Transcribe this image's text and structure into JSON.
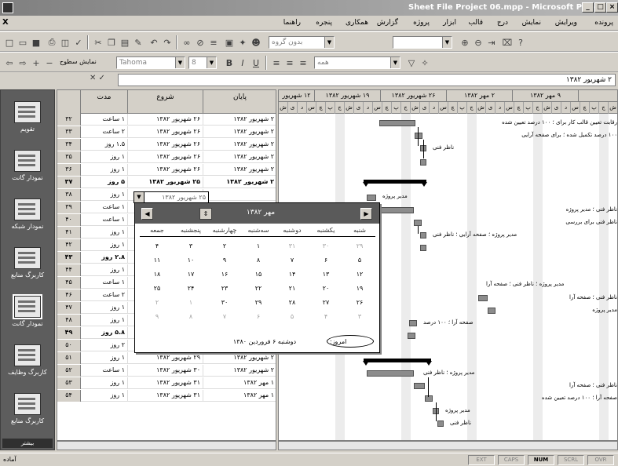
{
  "window": {
    "title": "Sheet File Project 06.mpp - Microsoft Project",
    "buttons": [
      "_",
      "□",
      "×"
    ]
  },
  "menubar": {
    "doc_icon": "X",
    "items": [
      "پرونده",
      "ویرایش",
      "نمایش",
      "درج",
      "قالب",
      "ابزار",
      "پروژه",
      "گزارش",
      "همکاری",
      "پنجره",
      "راهنما"
    ]
  },
  "toolbar1": {
    "icons": [
      "new-icon",
      "open-icon",
      "save-icon",
      "print-icon",
      "preview-icon",
      "spell-icon",
      "cut-icon",
      "copy-icon",
      "paste-icon",
      "format-painter-icon",
      "undo-icon",
      "redo-icon",
      "link-icon",
      "unlink-icon",
      "split-icon",
      "info-icon",
      "notes-icon",
      "assign-icon"
    ],
    "combo1": "بدون گروه",
    "combo2": "",
    "right_icons": [
      "zoom-in-icon",
      "zoom-out-icon",
      "goto-icon",
      "copy-picture-icon",
      "help-icon"
    ]
  },
  "toolbar2": {
    "icons": [
      "outdent-icon",
      "indent-icon",
      "show-subtasks-icon",
      "hide-subtasks-icon"
    ],
    "show_label": "نمایش سطوح",
    "font": "Tahoma",
    "size": "8",
    "fmt": [
      "B",
      "I",
      "U"
    ],
    "filter": "همه",
    "right_icons": [
      "autofilter-icon",
      "wizard-icon"
    ]
  },
  "entrybar": {
    "value": "۲ شهریور ۱۳۸۲"
  },
  "viewbar": {
    "items": [
      {
        "label": "تقویم",
        "icon": "calendar-view-icon"
      },
      {
        "label": "نمودار گانت",
        "icon": "gantt-view-icon"
      },
      {
        "label": "نمودار شبکه",
        "icon": "network-view-icon"
      },
      {
        "label": "کاربرگ منابع",
        "icon": "resource-sheet-icon"
      },
      {
        "label": "نمودار گانت",
        "icon": "tracking-gantt-icon"
      },
      {
        "label": "کاربرگ وظایف",
        "icon": "task-sheet-icon"
      },
      {
        "label": "کاربرگ منابع",
        "icon": "usage-icon"
      }
    ],
    "scroll_label": "بیشتر"
  },
  "table": {
    "headers": {
      "duration": "مدت",
      "start": "شروع",
      "finish": "پایان"
    },
    "rows": [
      {
        "id": "۳۲",
        "duration": "۱ ساعت",
        "start": "۲۶ شهریور ۱۳۸۲",
        "finish": "۲ شهریور ۱۳۸۲",
        "summary": false
      },
      {
        "id": "۳۳",
        "duration": "۲ ساعت",
        "start": "۲۶ شهریور ۱۳۸۲",
        "finish": "۲ شهریور ۱۳۸۲",
        "summary": false
      },
      {
        "id": "۳۴",
        "duration": "۱.۵ روز",
        "start": "۲۶ شهریور ۱۳۸۲",
        "finish": "۲ شهریور ۱۳۸۲",
        "summary": false
      },
      {
        "id": "۳۵",
        "duration": "۱ روز",
        "start": "۲۶ شهریور ۱۳۸۲",
        "finish": "۲ شهریور ۱۳۸۲",
        "summary": false
      },
      {
        "id": "۳۶",
        "duration": "۱ روز",
        "start": "۲۶ شهریور ۱۳۸۲",
        "finish": "۲ شهریور ۱۳۸۲",
        "summary": false
      },
      {
        "id": "۳۷",
        "duration": "۵ روز",
        "start": "۲۵ شهریور ۱۳۸۲",
        "finish": "۲ شهریور ۱۳۸۲",
        "summary": true
      },
      {
        "id": "۳۸",
        "duration": "۱ روز",
        "start": "۲۵ شهریور ۱۳۸۲",
        "finish": "",
        "summary": false
      },
      {
        "id": "۳۹",
        "duration": "۱ ساعت",
        "start": "",
        "finish": "",
        "summary": false
      },
      {
        "id": "۴۰",
        "duration": "۱ ساعت",
        "start": "",
        "finish": "",
        "summary": false
      },
      {
        "id": "۴۱",
        "duration": "۱ روز",
        "start": "",
        "finish": "",
        "summary": false
      },
      {
        "id": "۴۲",
        "duration": "۱ روز",
        "start": "",
        "finish": "",
        "summary": false
      },
      {
        "id": "۴۳",
        "duration": "۲.۸ روز",
        "start": "",
        "finish": "",
        "summary": true
      },
      {
        "id": "۴۴",
        "duration": "۱ روز",
        "start": "",
        "finish": "",
        "summary": false
      },
      {
        "id": "۴۵",
        "duration": "۱ ساعت",
        "start": "",
        "finish": "",
        "summary": false
      },
      {
        "id": "۴۶",
        "duration": "۲ ساعت",
        "start": "",
        "finish": "",
        "summary": false
      },
      {
        "id": "۴۷",
        "duration": "۱ روز",
        "start": "",
        "finish": "",
        "summary": false
      },
      {
        "id": "۴۸",
        "duration": "۱ روز",
        "start": "",
        "finish": "",
        "summary": false
      },
      {
        "id": "۴۹",
        "duration": "۵.۸ روز",
        "start": "۲۵ شهریور ۱۳۸۲",
        "finish": "۱ مهر ۱۳۸۲",
        "summary": true
      },
      {
        "id": "۵۰",
        "duration": "۲ روز",
        "start": "۲۵ شهریور ۱۳۸۲",
        "finish": "۲ شهریور ۱۳۸۲",
        "summary": false
      },
      {
        "id": "۵۱",
        "duration": "۱ روز",
        "start": "۲۹ شهریور ۱۳۸۲",
        "finish": "۲ شهریور ۱۳۸۲",
        "summary": false
      },
      {
        "id": "۵۲",
        "duration": "۱ ساعت",
        "start": "۳۰ شهریور ۱۳۸۲",
        "finish": "۲ شهریور ۱۳۸۲",
        "summary": false
      },
      {
        "id": "۵۳",
        "duration": "۱ روز",
        "start": "۳۱ شهریور ۱۳۸۲",
        "finish": "۱ مهر ۱۳۸۲",
        "summary": false
      },
      {
        "id": "۵۴",
        "duration": "۱ روز",
        "start": "۳۱ شهریور ۱۳۸۲",
        "finish": "۱ مهر ۱۳۸۲",
        "summary": false
      }
    ]
  },
  "editcell": {
    "value": "۲۵ شهریور ۱۳۸۲"
  },
  "gantt": {
    "weeks": [
      "۱۲ شهریور ۸۲",
      "۱۹ شهریور ۱۳۸۲",
      "۲۶ شهریور ۱۳۸۲",
      "۲ مهر ۱۳۸۲",
      "۹ مهر ۱۳۸۲"
    ],
    "days": [
      "ش",
      "ی",
      "د",
      "س",
      "چ",
      "پ",
      "ج"
    ],
    "labels": [
      "رقابت تعیین قالب کار برای ؛ ۱۰۰ درصد تعیین شده",
      "۱۰۰ درصد تکمیل شده ؛ برای صفحه آرایی",
      "ناظر فنی",
      "مدیر پروژه",
      "ناظر فنی ؛ مدیر پروژه",
      "ناظر فنی برای بررسی",
      "مدیر پروژه ؛ صفحه آرایی ؛ ناظر فنی",
      "مدیر پروژه ؛ ناظر فنی ؛ صفحه آرا",
      "ناظر فنی ؛ صفحه آرا",
      "مدیر پروژه",
      "صفحه آرا ؛ ۱۰۰ درصد",
      "مدیر پروژه ؛ ناظر فنی",
      "ناظر فنی ؛ صفحه آرا",
      "صفحه آرا ؛ ۱۰۰ درصد تعیین شده",
      "مدیر پروژه",
      "ناظر فنی"
    ]
  },
  "calendar": {
    "month": "مهر ۱۳۸۲",
    "weekdays": [
      "جمعه",
      "پنجشنبه",
      "چهارشنبه",
      "سه‌شنبه",
      "دوشنبه",
      "یکشنبه",
      "شنبه"
    ],
    "weeks": [
      [
        "۴",
        "۳",
        "۲",
        "۱",
        "۳۱",
        "۳۰",
        "۲۹"
      ],
      [
        "۱۱",
        "۱۰",
        "۹",
        "۸",
        "۷",
        "۶",
        "۵"
      ],
      [
        "۱۸",
        "۱۷",
        "۱۶",
        "۱۵",
        "۱۴",
        "۱۳",
        "۱۲"
      ],
      [
        "۲۵",
        "۲۴",
        "۲۳",
        "۲۲",
        "۲۱",
        "۲۰",
        "۱۹"
      ],
      [
        "۲",
        "۱",
        "۳۰",
        "۲۹",
        "۲۸",
        "۲۷",
        "۲۶"
      ],
      [
        "۹",
        "۸",
        "۷",
        "۶",
        "۵",
        "۴",
        "۳"
      ]
    ],
    "other_month": [
      [
        false,
        false,
        false,
        false,
        true,
        true,
        true
      ],
      [
        false,
        false,
        false,
        false,
        false,
        false,
        false
      ],
      [
        false,
        false,
        false,
        false,
        false,
        false,
        false
      ],
      [
        false,
        false,
        false,
        false,
        false,
        false,
        false
      ],
      [
        true,
        true,
        false,
        false,
        false,
        false,
        false
      ],
      [
        true,
        true,
        true,
        true,
        true,
        true,
        true
      ]
    ],
    "today_label": "امروز:",
    "today_value": "دوشنبه ۶ فروردین ۱۳۸۰"
  },
  "status": {
    "ready": "آماده",
    "indicators": [
      "EXT",
      "CAPS",
      "NUM",
      "SCRL",
      "OVR"
    ],
    "active": [
      false,
      false,
      true,
      false,
      false
    ]
  }
}
